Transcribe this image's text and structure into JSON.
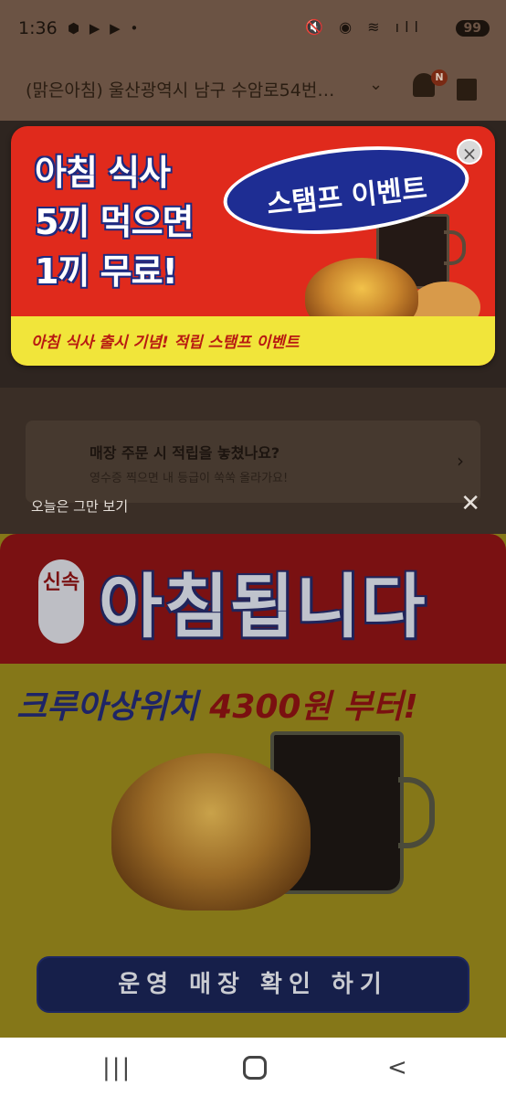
{
  "status_bar": {
    "time": "1:36",
    "left_icons": "⬢ ▶ ▶ •",
    "right_icons": "🔇 ◉ ≋ ıll",
    "battery": "99"
  },
  "header": {
    "address": "(맑은아침) 울산광역시 남구 수암로54번…",
    "notification_badge": "N"
  },
  "background_card": {
    "title": "매장 주문 시 적립을 놓쳤나요?",
    "subtitle": "영수증 찍으면 내 등급이 쑥쑥 올라가요!"
  },
  "popup": {
    "headline_line1": "아침 식사",
    "headline_line2": "5끼 먹으면",
    "headline_line3": "1끼 무료!",
    "badge_text": "스탬프 이벤트",
    "strip_text": "아침 식사 출시 기념! 적립 스탬프 이벤트",
    "close_symbol": "×"
  },
  "dismiss": {
    "label": "오늘은 그만 보기",
    "close_symbol": "✕"
  },
  "ad": {
    "sinsok": "신속",
    "headline": "아침됩니다",
    "promo_blue": "크루아상위치",
    "promo_red": "4300원 부터!",
    "cta": "운영 매장 확인 하기"
  },
  "navbar": {
    "recents": "|||",
    "back": "<"
  },
  "colors": {
    "popup_red": "#e02a1c",
    "popup_yellow": "#f1e53a",
    "oval_blue": "#1e2d93",
    "ad_red": "#7a1112",
    "ad_olive": "#857718",
    "cta_navy": "#161f4a"
  }
}
